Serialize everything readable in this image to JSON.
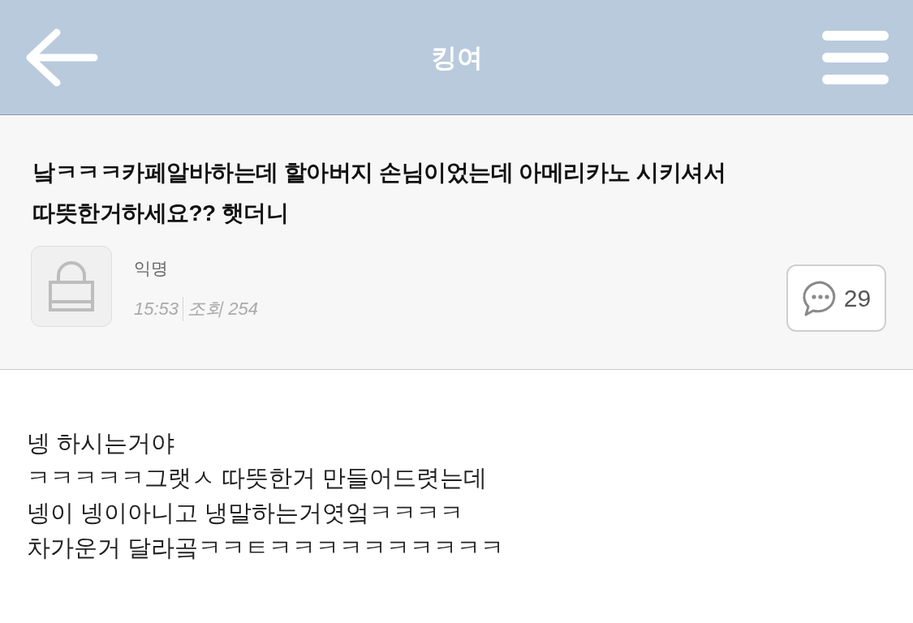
{
  "header": {
    "title": "킹여"
  },
  "post": {
    "title": "낰ㅋㅋㅋ카페알바하는데 할아버지 손님이었는데 아메리카노 시키셔서 따뜻한거하세요?? 햇더니",
    "author": "익명",
    "time": "15:53",
    "views": "조회 254",
    "comments": "29"
  },
  "body": {
    "lines": [
      "넹 하시는거야",
      "ㅋㅋㅋㅋㅋ그랫ㅅ 따뜻한거 만들어드렷는데",
      "넹이 넹이아니고 냉말하는거엿엌ㅋㅋㅋㅋ",
      "차가운거 달라곸ㅋㅋㅌㅋㅋㅋㅋㅋㅋㅋㅋㅋㅋ"
    ]
  }
}
